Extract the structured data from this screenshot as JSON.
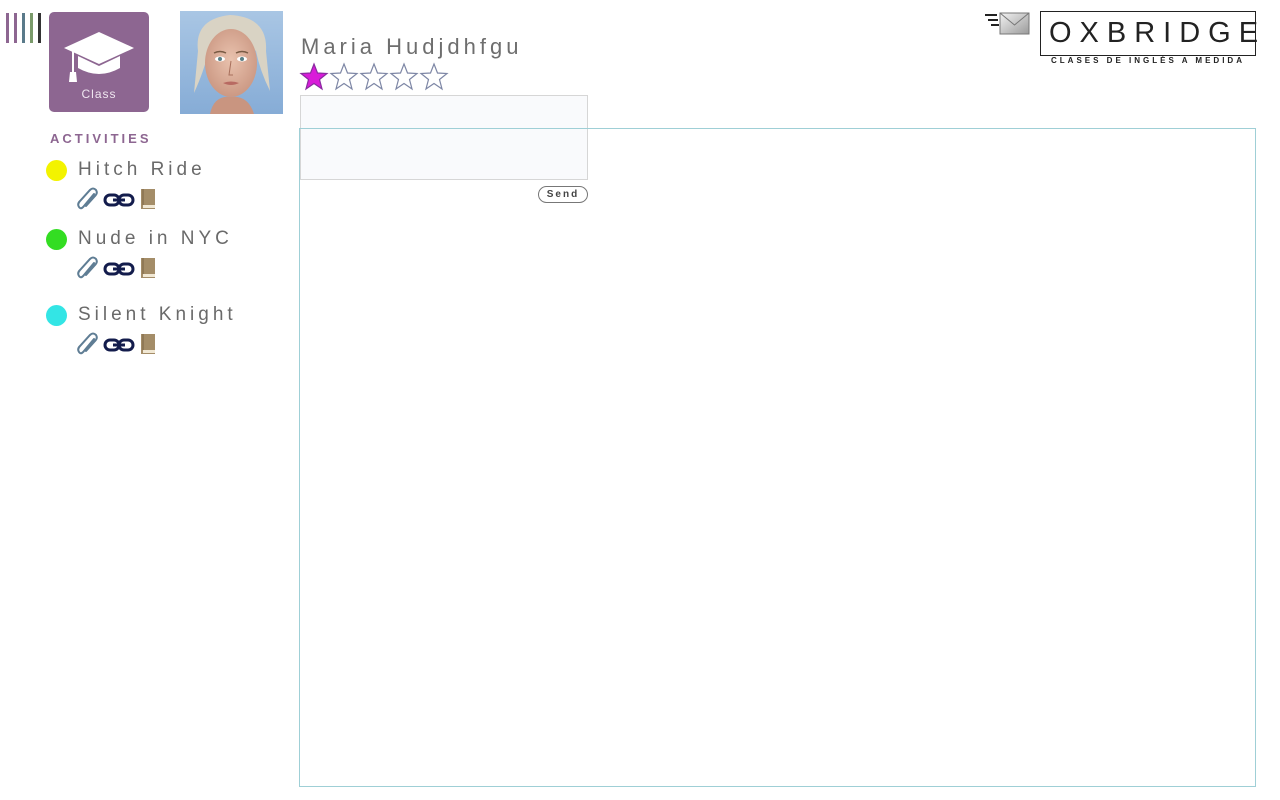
{
  "header": {
    "class_label": "Class",
    "student_name": "Maria Hudjdhfgu",
    "rating": {
      "value": 1,
      "max": 5
    }
  },
  "menu_bar_colors": [
    "#8d6691",
    "#8d6691",
    "#5a7a8a",
    "#7a9a6a",
    "#333333"
  ],
  "message": {
    "value": "",
    "placeholder": "",
    "send_label": "Send"
  },
  "brand": {
    "name": "OXBRIDGE",
    "tagline": "CLASES DE INGLÉS A MEDIDA"
  },
  "activities": {
    "heading": "ACTIVITIES",
    "items": [
      {
        "title": "Hitch Ride",
        "color": "#f3f300"
      },
      {
        "title": "Nude in NYC",
        "color": "#33dd22"
      },
      {
        "title": "Silent Knight",
        "color": "#33e5e5"
      }
    ]
  },
  "colors": {
    "accent": "#8d6691",
    "star_filled": "#d91bd9",
    "star_empty": "#7d86a5",
    "frame_border": "#9fcfd6"
  }
}
